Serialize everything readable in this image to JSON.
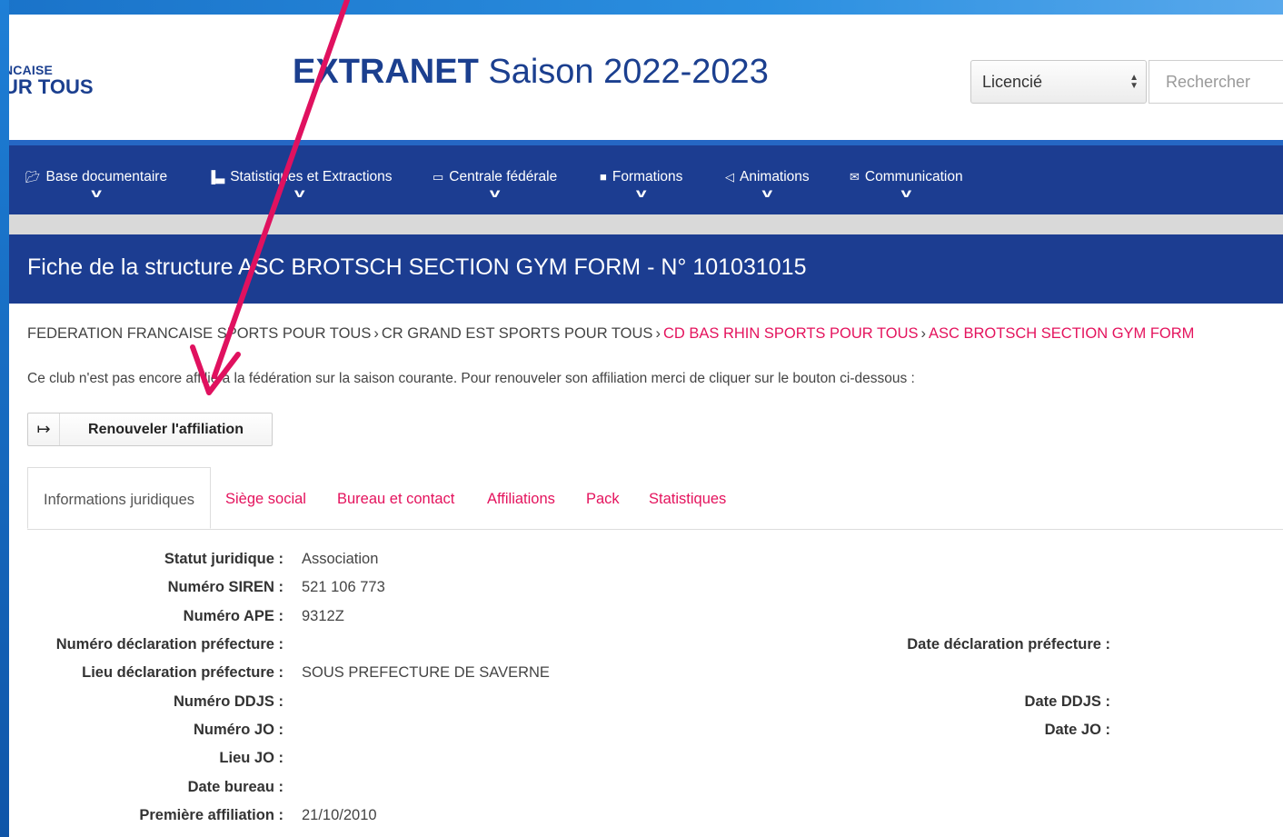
{
  "header": {
    "logo_line1": "NCAISE",
    "logo_line2": "UR TOUS",
    "title_bold": "EXTRANET",
    "title_rest": " Saison 2022-2023",
    "role_select_value": "Licencié",
    "search_placeholder": "Rechercher"
  },
  "nav": {
    "items": [
      {
        "label": "Base documentaire",
        "icon": "folder-icon"
      },
      {
        "label": "Statistiques et Extractions",
        "icon": "bar-chart-icon"
      },
      {
        "label": "Centrale fédérale",
        "icon": "credit-card-icon"
      },
      {
        "label": "Formations",
        "icon": "briefcase-icon"
      },
      {
        "label": "Animations",
        "icon": "bullhorn-icon"
      },
      {
        "label": "Communication",
        "icon": "envelope-icon"
      }
    ]
  },
  "structure": {
    "title": "Fiche de la structure ASC BROTSCH SECTION GYM FORM - N° 101031015"
  },
  "breadcrumb": {
    "items": [
      "FEDERATION FRANCAISE SPORTS POUR TOUS",
      "CR GRAND EST SPORTS POUR TOUS",
      "CD BAS RHIN SPORTS POUR TOUS",
      "ASC BROTSCH SECTION GYM FORM"
    ],
    "separator": "›"
  },
  "notice": "Ce club n'est pas encore affilié à la fédération sur la saison courante. Pour renouveler son affiliation merci de cliquer sur le bouton ci-dessous :",
  "renew_button": {
    "label": "Renouveler l'affiliation",
    "icon": "sign-out-icon"
  },
  "tabs": [
    {
      "label": "Informations juridiques",
      "active": true
    },
    {
      "label": "Siège social"
    },
    {
      "label": "Bureau et contact"
    },
    {
      "label": "Affiliations"
    },
    {
      "label": "Pack"
    },
    {
      "label": "Statistiques"
    }
  ],
  "info": {
    "statut_label": "Statut juridique :",
    "statut_value": "Association",
    "siren_label": "Numéro SIREN :",
    "siren_value": "521 106 773",
    "ape_label": "Numéro APE :",
    "ape_value": "9312Z",
    "num_decl_label": "Numéro déclaration préfecture :",
    "date_decl_label": "Date déclaration préfecture :",
    "lieu_decl_label": "Lieu déclaration préfecture :",
    "lieu_decl_value": "SOUS PREFECTURE DE SAVERNE",
    "ddjs_label": "Numéro DDJS :",
    "date_ddjs_label": "Date DDJS :",
    "jo_label": "Numéro JO :",
    "date_jo_label": "Date JO :",
    "lieu_jo_label": "Lieu JO :",
    "date_bureau_label": "Date bureau :",
    "premiere_label": "Première affiliation :",
    "premiere_value": "21/10/2010"
  },
  "colors": {
    "brand_blue": "#1c3d91",
    "accent_pink": "#e4135d",
    "annotation_arrow": "#e0115f"
  }
}
